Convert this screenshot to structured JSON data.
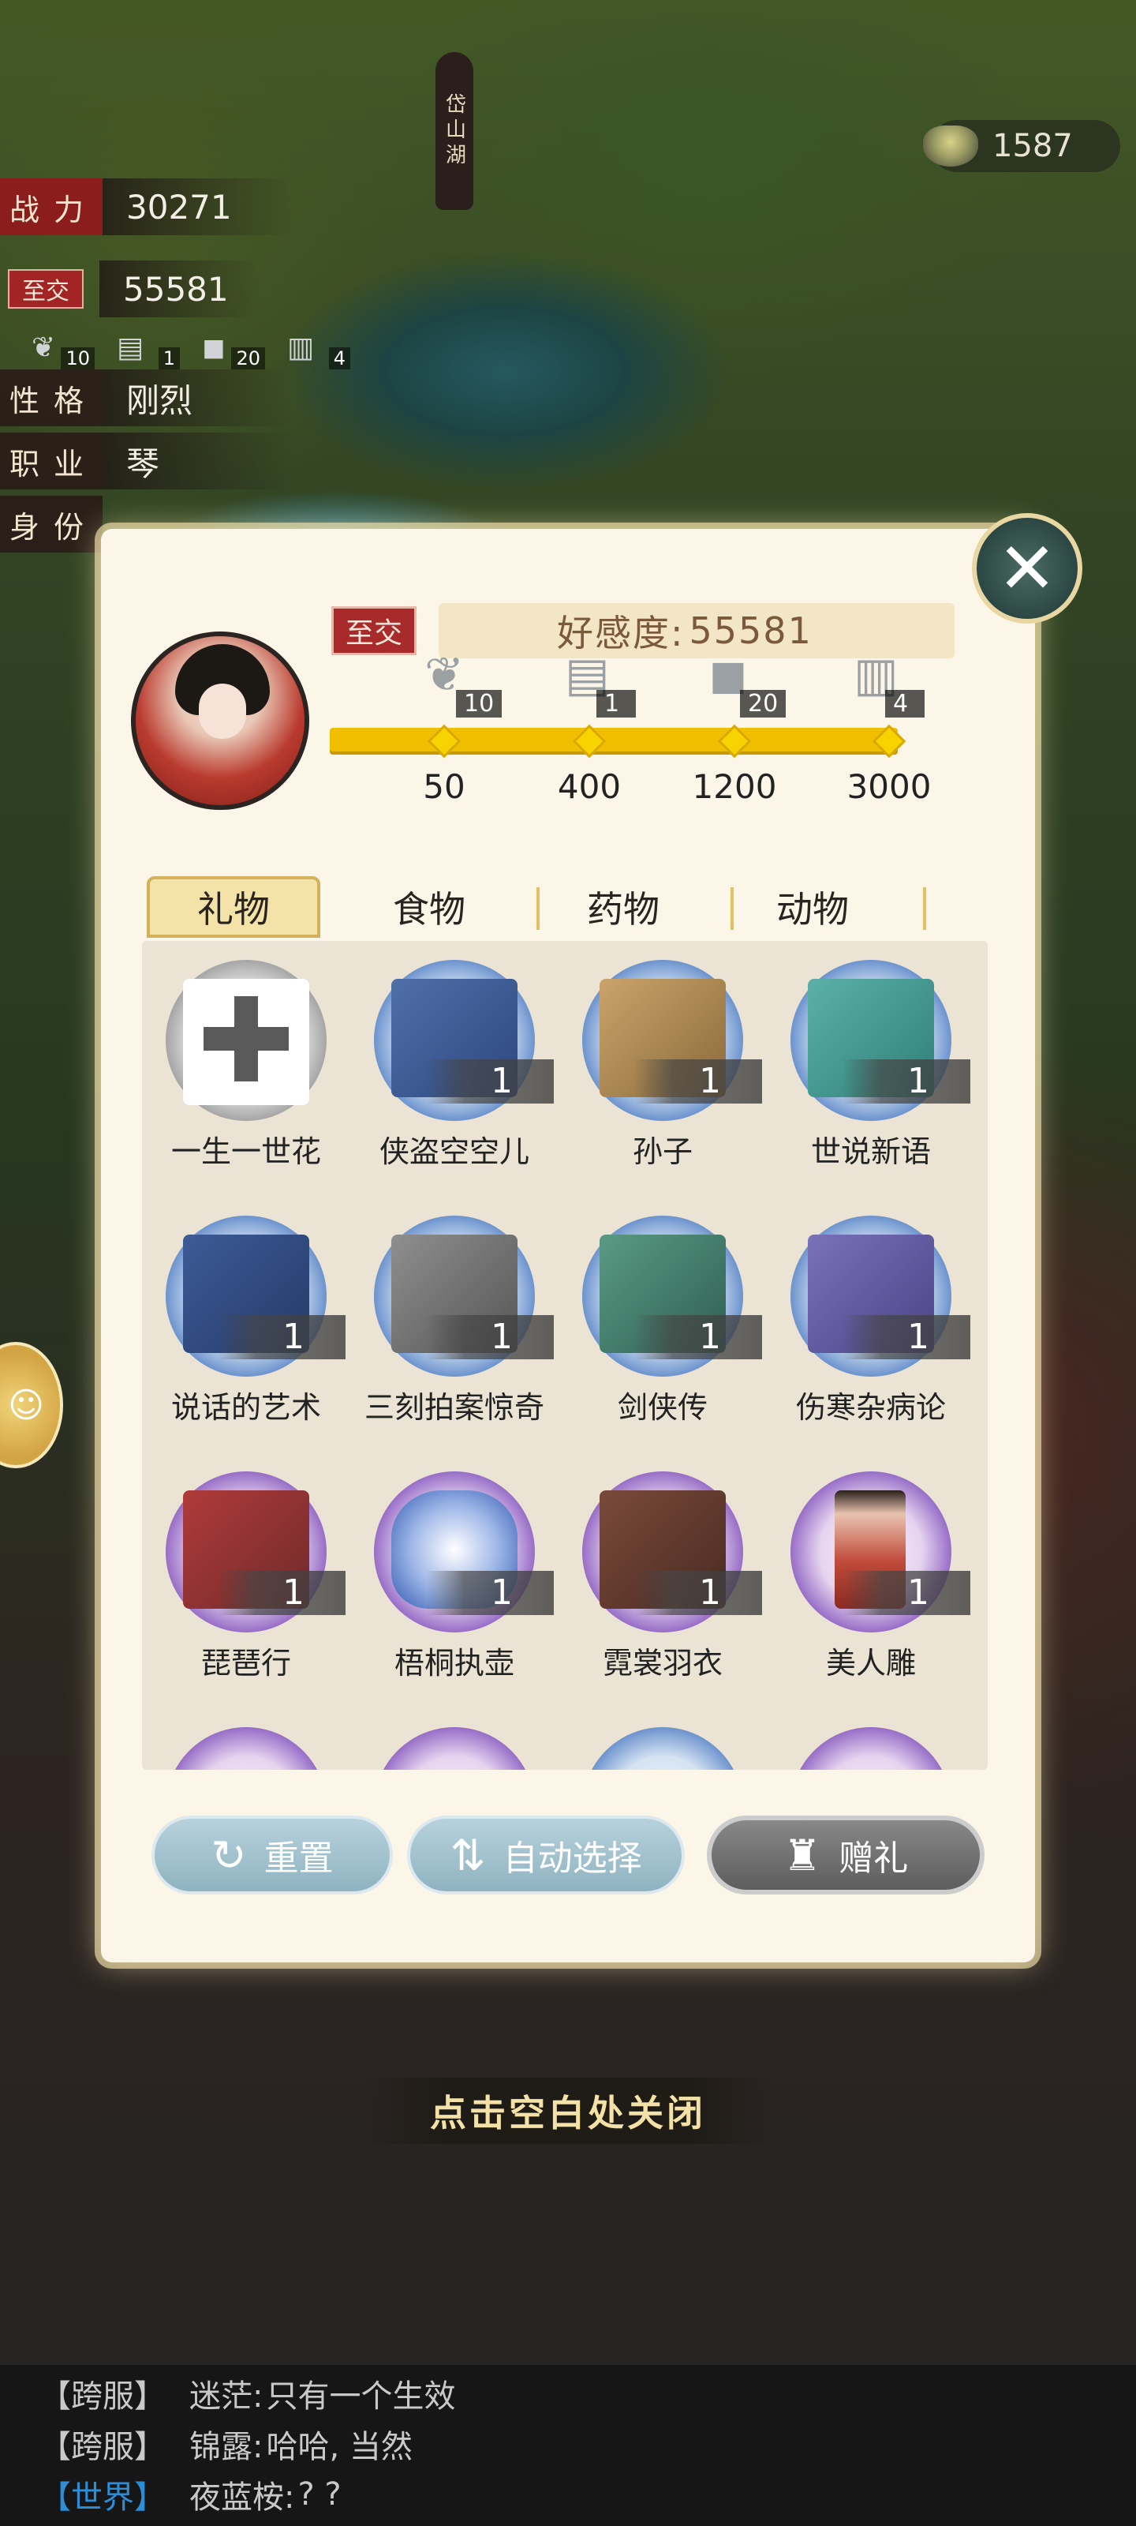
{
  "stats": {
    "power_label": "战力",
    "power_value": "30271",
    "relation_badge": "至交",
    "relation_value": "55581",
    "personality_label": "性格",
    "personality_value": "刚烈",
    "job_label": "职业",
    "job_value": "琴",
    "identity_label": "身份"
  },
  "mini_items": [
    {
      "icon": "grass-icon",
      "count": "10"
    },
    {
      "icon": "book-icon",
      "count": "1"
    },
    {
      "icon": "stone-icon",
      "count": "20"
    },
    {
      "icon": "book-stack-icon",
      "count": "4"
    }
  ],
  "location": "岱山湖",
  "currency": {
    "icon": "tea-bowl-icon",
    "amount": "1587"
  },
  "dialog": {
    "relation_badge": "至交",
    "affection_label": "好感度:",
    "affection_value": "55581",
    "milestones": [
      {
        "icon": "grass-icon",
        "count": "10",
        "value": "50"
      },
      {
        "icon": "book-icon",
        "count": "1",
        "value": "400"
      },
      {
        "icon": "stone-icon",
        "count": "20",
        "value": "1200"
      },
      {
        "icon": "book-stack-icon",
        "count": "4",
        "value": "3000"
      }
    ],
    "progress_fraction": 1.0,
    "tabs": [
      "礼物",
      "食物",
      "药物",
      "动物"
    ],
    "active_tab": "礼物",
    "items": [
      {
        "name": "一生一世花",
        "count": "",
        "rarity": "grey"
      },
      {
        "name": "侠盗空空儿",
        "count": "1",
        "rarity": "blue"
      },
      {
        "name": "孙子",
        "count": "1",
        "rarity": "blue"
      },
      {
        "name": "世说新语",
        "count": "1",
        "rarity": "blue"
      },
      {
        "name": "说话的艺术",
        "count": "1",
        "rarity": "blue"
      },
      {
        "name": "三刻拍案惊奇",
        "count": "1",
        "rarity": "blue"
      },
      {
        "name": "剑侠传",
        "count": "1",
        "rarity": "blue"
      },
      {
        "name": "伤寒杂病论",
        "count": "1",
        "rarity": "blue"
      },
      {
        "name": "琵琶行",
        "count": "1",
        "rarity": "purple"
      },
      {
        "name": "梧桐执壶",
        "count": "1",
        "rarity": "purple"
      },
      {
        "name": "霓裳羽衣",
        "count": "1",
        "rarity": "purple"
      },
      {
        "name": "美人雕",
        "count": "1",
        "rarity": "purple"
      }
    ],
    "buttons": {
      "reset": "重置",
      "auto_select": "自动选择",
      "gift": "赠礼"
    }
  },
  "close_hint": "点击空白处关闭",
  "chat": [
    {
      "channel": "【跨服】",
      "name": "迷茫:",
      "text": "只有一个生效",
      "world": false
    },
    {
      "channel": "【跨服】",
      "name": "锦露:",
      "text": "哈哈, 当然",
      "world": false
    },
    {
      "channel": "【世界】",
      "name": "夜蓝桉:",
      "text": "? ?",
      "world": true
    }
  ],
  "colors": {
    "progress": "#f0c000",
    "relation_red": "#a82a2a",
    "dialog_bg": "#fbf6e8",
    "world_channel": "#2d8ed8"
  }
}
